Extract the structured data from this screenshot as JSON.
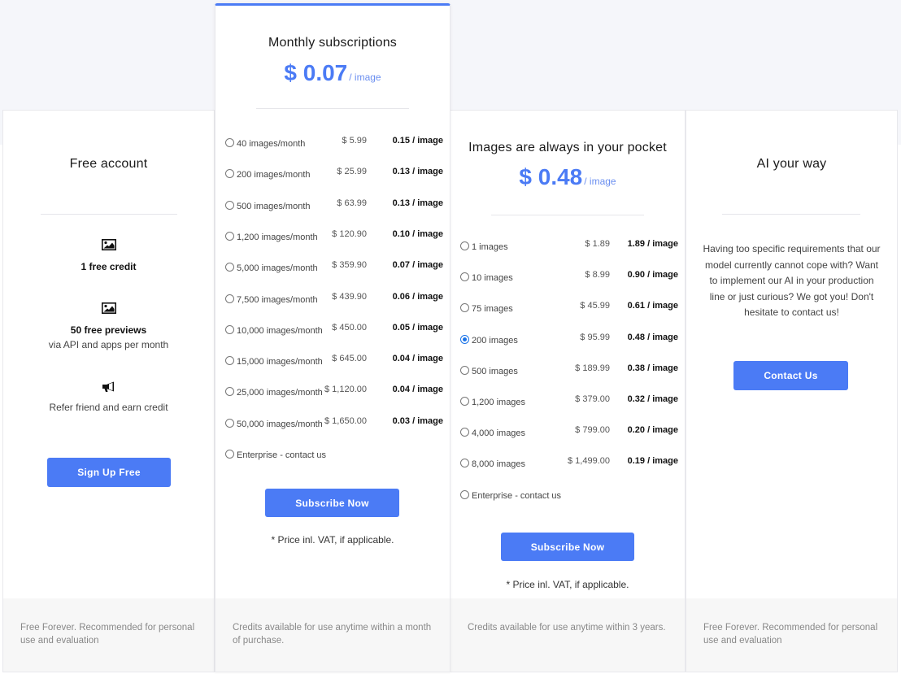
{
  "theme": {
    "accent": "#4b7bf5",
    "radio_checked": "#1a73e8"
  },
  "free": {
    "title": "Free account",
    "features": [
      {
        "icon": "image-icon",
        "strong": "1 free credit",
        "sub": ""
      },
      {
        "icon": "image-icon",
        "strong": "50 free previews",
        "sub": "via API and apps per month"
      },
      {
        "icon": "megaphone-icon",
        "strong": "",
        "sub": "Refer friend and earn credit"
      }
    ],
    "button": "Sign Up Free",
    "footer": "Free Forever. Recommended for personal use and evaluation"
  },
  "monthly": {
    "title": "Monthly subscriptions",
    "price": "$ 0.07",
    "price_unit": "/ image",
    "options": [
      {
        "label": "40 images/month",
        "price": "$ 5.99",
        "per": "0.15 / image",
        "checked": false
      },
      {
        "label": "200 images/month",
        "price": "$ 25.99",
        "per": "0.13 / image",
        "checked": false
      },
      {
        "label": "500 images/month",
        "price": "$ 63.99",
        "per": "0.13 / image",
        "checked": false
      },
      {
        "label": "1,200 images/month",
        "price": "$ 120.90",
        "per": "0.10 / image",
        "checked": false
      },
      {
        "label": "5,000 images/month",
        "price": "$ 359.90",
        "per": "0.07 / image",
        "checked": false
      },
      {
        "label": "7,500 images/month",
        "price": "$ 439.90",
        "per": "0.06 / image",
        "checked": false
      },
      {
        "label": "10,000 images/month",
        "price": "$ 450.00",
        "per": "0.05 / image",
        "checked": false
      },
      {
        "label": "15,000 images/month",
        "price": "$ 645.00",
        "per": "0.04 / image",
        "checked": false
      },
      {
        "label": "25,000 images/month",
        "price": "$ 1,120.00",
        "per": "0.04 / image",
        "checked": false
      },
      {
        "label": "50,000 images/month",
        "price": "$ 1,650.00",
        "per": "0.03 / image",
        "checked": false
      },
      {
        "label": "Enterprise - contact us",
        "price": "",
        "per": "",
        "checked": false
      }
    ],
    "button": "Subscribe Now",
    "note": "* Price inl. VAT, if applicable.",
    "footer": "Credits available for use anytime within a month of purchase."
  },
  "pocket": {
    "title": "Images are always in your pocket",
    "price": "$ 0.48",
    "price_unit": "/ image",
    "options": [
      {
        "label": "1 images",
        "price": "$ 1.89",
        "per": "1.89 / image",
        "checked": false
      },
      {
        "label": "10 images",
        "price": "$ 8.99",
        "per": "0.90 / image",
        "checked": false
      },
      {
        "label": "75 images",
        "price": "$ 45.99",
        "per": "0.61 / image",
        "checked": false
      },
      {
        "label": "200 images",
        "price": "$ 95.99",
        "per": "0.48 / image",
        "checked": true
      },
      {
        "label": "500 images",
        "price": "$ 189.99",
        "per": "0.38 / image",
        "checked": false
      },
      {
        "label": "1,200 images",
        "price": "$ 379.00",
        "per": "0.32 / image",
        "checked": false
      },
      {
        "label": "4,000 images",
        "price": "$ 799.00",
        "per": "0.20 / image",
        "checked": false
      },
      {
        "label": "8,000 images",
        "price": "$ 1,499.00",
        "per": "0.19 / image",
        "checked": false
      },
      {
        "label": "Enterprise - contact us",
        "price": "",
        "per": "",
        "checked": false
      }
    ],
    "button": "Subscribe Now",
    "note": "* Price inl. VAT, if applicable.",
    "footer": "Credits available for use anytime within 3 years."
  },
  "ai": {
    "title": "AI your way",
    "text": "Having too specific requirements that our model currently cannot cope with? Want to implement our AI in your production line or just curious? We got you! Don't hesitate to contact us!",
    "button": "Contact Us",
    "footer": "Free Forever. Recommended for personal use and evaluation"
  }
}
